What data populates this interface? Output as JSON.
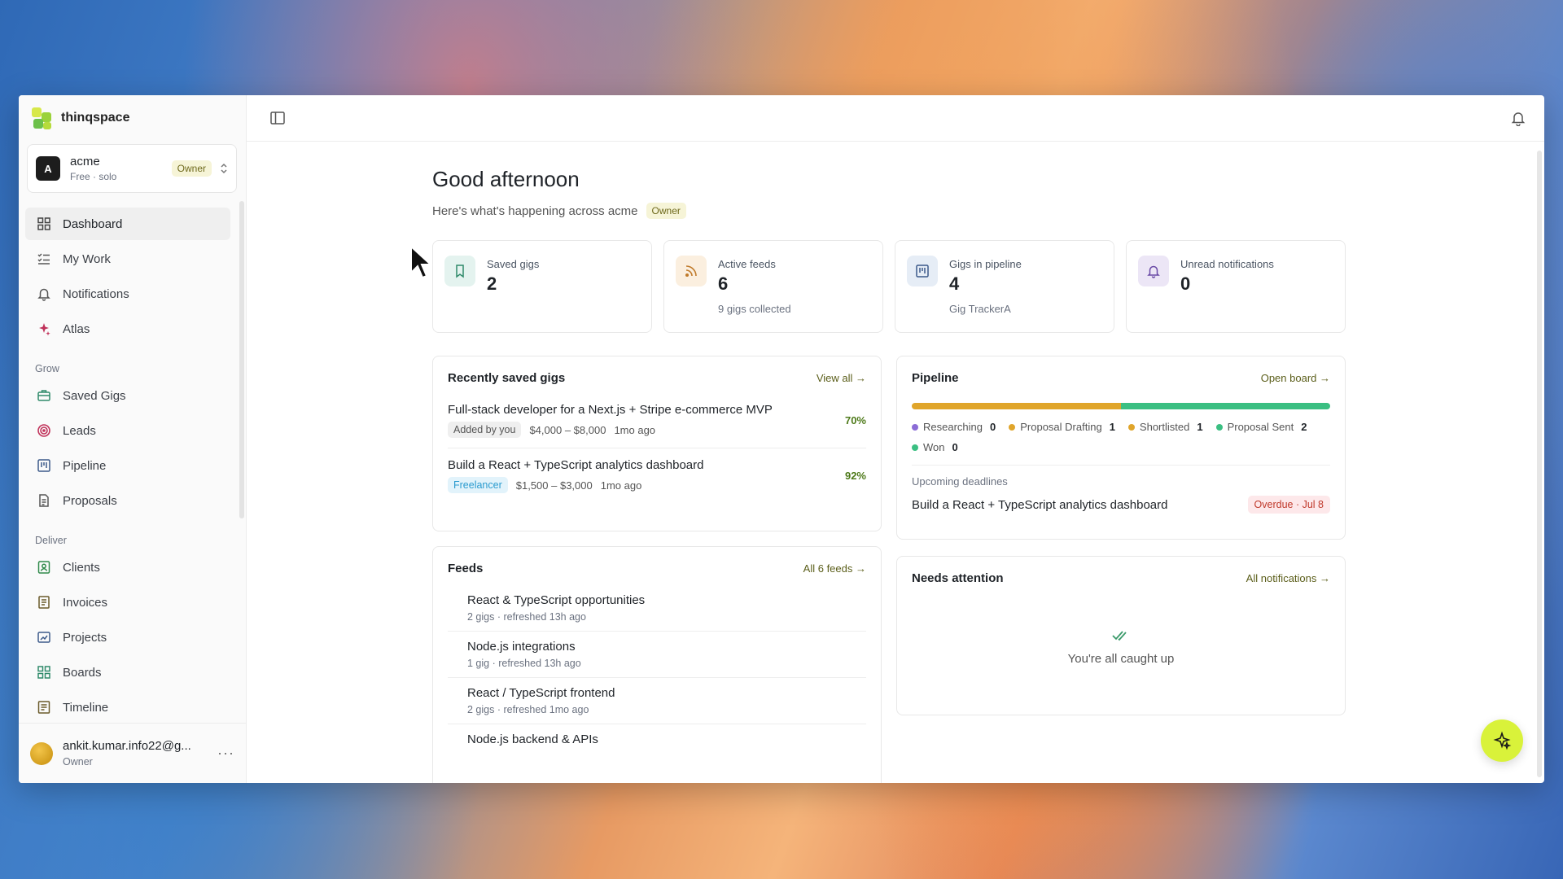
{
  "brand": {
    "name": "thinqspace"
  },
  "workspace": {
    "initial": "A",
    "name": "acme",
    "plan": "Free · solo",
    "role": "Owner"
  },
  "nav": {
    "top": [
      {
        "label": "Dashboard",
        "icon": "grid-icon",
        "active": true
      },
      {
        "label": "My Work",
        "icon": "checklist-icon"
      },
      {
        "label": "Notifications",
        "icon": "bell-icon"
      },
      {
        "label": "Atlas",
        "icon": "sparkle-icon"
      }
    ],
    "grow_label": "Grow",
    "grow": [
      {
        "label": "Saved Gigs",
        "icon": "briefcase-icon"
      },
      {
        "label": "Leads",
        "icon": "target-icon"
      },
      {
        "label": "Pipeline",
        "icon": "kanban-icon"
      },
      {
        "label": "Proposals",
        "icon": "document-icon"
      }
    ],
    "deliver_label": "Deliver",
    "deliver": [
      {
        "label": "Clients",
        "icon": "contact-icon"
      },
      {
        "label": "Invoices",
        "icon": "invoice-icon"
      },
      {
        "label": "Projects",
        "icon": "folder-icon"
      },
      {
        "label": "Boards",
        "icon": "boards-icon"
      },
      {
        "label": "Timeline",
        "icon": "timeline-icon"
      }
    ]
  },
  "user": {
    "email": "ankit.kumar.info22@g...",
    "role": "Owner",
    "more": "···"
  },
  "header": {
    "greeting": "Good afternoon",
    "subtitle": "Here's what's happening across acme",
    "role_badge": "Owner"
  },
  "stats": [
    {
      "label": "Saved gigs",
      "value": "2",
      "sub": "",
      "icon": "bookmark-icon",
      "color": "#e4f3ef"
    },
    {
      "label": "Active feeds",
      "value": "6",
      "sub": "9 gigs collected",
      "icon": "rss-icon",
      "color": "#fbefdf"
    },
    {
      "label": "Gigs in pipeline",
      "value": "4",
      "sub": "Gig TrackerA",
      "icon": "kanban-icon",
      "color": "#e6edf6"
    },
    {
      "label": "Unread notifications",
      "value": "0",
      "sub": "",
      "icon": "bell-icon",
      "color": "#ece6f6"
    }
  ],
  "recent": {
    "title": "Recently saved gigs",
    "link": "View all →",
    "items": [
      {
        "title": "Full-stack developer for a Next.js + Stripe e-commerce MVP",
        "tag": "Added by you",
        "budget": "$4,000 – $8,000",
        "age": "1mo ago",
        "score": "70%"
      },
      {
        "title": "Build a React + TypeScript analytics dashboard",
        "tag": "Freelancer",
        "budget": "$1,500 – $3,000",
        "age": "1mo ago",
        "score": "92%"
      }
    ]
  },
  "pipeline": {
    "title": "Pipeline",
    "link": "Open board →",
    "bar": [
      {
        "share": 0.5,
        "color": "#e0a52b"
      },
      {
        "share": 0.5,
        "color": "#3bbf82"
      }
    ],
    "legend": [
      {
        "label": "Researching",
        "count": "0",
        "color": "#8b6cd6"
      },
      {
        "label": "Proposal Drafting",
        "count": "1",
        "color": "#e0a52b"
      },
      {
        "label": "Shortlisted",
        "count": "1",
        "color": "#e0a52b"
      },
      {
        "label": "Proposal Sent",
        "count": "2",
        "color": "#3bbf82"
      },
      {
        "label": "Won",
        "count": "0",
        "color": "#3bbf82"
      }
    ],
    "deadlines_label": "Upcoming deadlines",
    "deadline": {
      "title": "Build a React + TypeScript analytics dashboard",
      "status": "Overdue · Jul 8"
    }
  },
  "feeds": {
    "title": "Feeds",
    "link": "All 6 feeds →",
    "items": [
      {
        "title": "React & TypeScript opportunities",
        "meta": "2 gigs · refreshed 13h ago"
      },
      {
        "title": "Node.js integrations",
        "meta": "1 gig · refreshed 13h ago"
      },
      {
        "title": "React / TypeScript frontend",
        "meta": "2 gigs · refreshed 1mo ago"
      },
      {
        "title": "Node.js backend & APIs",
        "meta": ""
      }
    ]
  },
  "attention": {
    "title": "Needs attention",
    "link": "All notifications →",
    "empty": "You're all caught up"
  },
  "colors": {
    "accent": "#d9f23a",
    "owner_badge_bg": "#f6f4d7",
    "link": "#5b5e1a"
  }
}
